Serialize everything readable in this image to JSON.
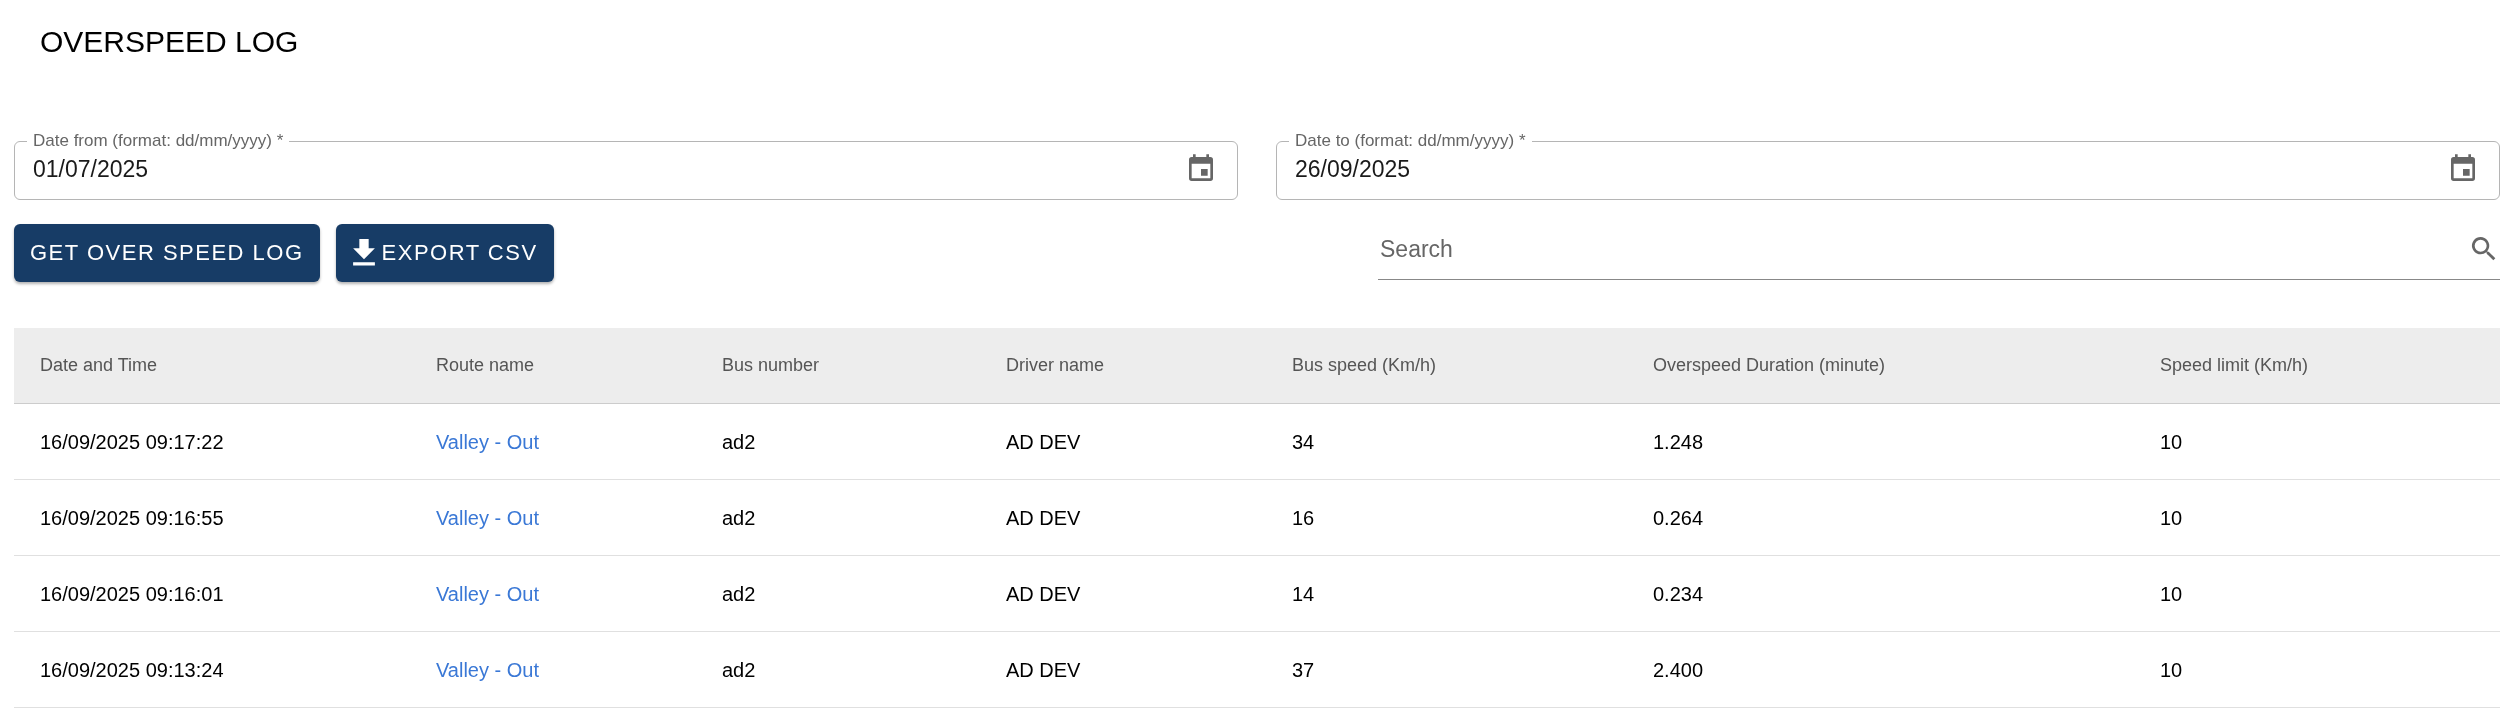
{
  "title": "OVERSPEED LOG",
  "date_from": {
    "label": "Date from (format: dd/mm/yyyy) *",
    "value": "01/07/2025"
  },
  "date_to": {
    "label": "Date to (format: dd/mm/yyyy) *",
    "value": "26/09/2025"
  },
  "buttons": [
    {
      "label": "GET OVER SPEED LOG",
      "kind": "plain"
    },
    {
      "label": "EXPORT CSV",
      "kind": "download"
    }
  ],
  "search": {
    "placeholder": "Search"
  },
  "table": {
    "columns": [
      "Date and Time",
      "Route name",
      "Bus number",
      "Driver name",
      "Bus speed (Km/h)",
      "Overspeed Duration (minute)",
      "Speed limit (Km/h)"
    ],
    "rows": [
      [
        "16/09/2025 09:17:22",
        "Valley - Out",
        "ad2",
        "AD DEV",
        "34",
        "1.248",
        "10"
      ],
      [
        "16/09/2025 09:16:55",
        "Valley - Out",
        "ad2",
        "AD DEV",
        "16",
        "0.264",
        "10"
      ],
      [
        "16/09/2025 09:16:01",
        "Valley - Out",
        "ad2",
        "AD DEV",
        "14",
        "0.234",
        "10"
      ],
      [
        "16/09/2025 09:13:24",
        "Valley - Out",
        "ad2",
        "AD DEV",
        "37",
        "2.400",
        "10"
      ]
    ]
  }
}
